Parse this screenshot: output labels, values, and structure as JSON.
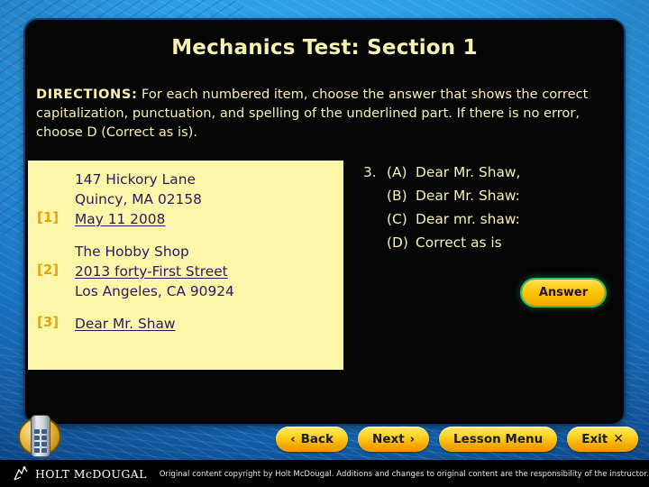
{
  "slide": {
    "title": "Mechanics Test: Section 1",
    "directions": {
      "lead": "DIRECTIONS:",
      "body": " For each numbered item, choose the answer that shows the correct capitalization, punctuation, and spelling of the underlined part. If there is no error, choose D (Correct as is)."
    }
  },
  "passage": {
    "rows": [
      {
        "num": "",
        "text": "147 Hickory Lane",
        "underline": false
      },
      {
        "num": "",
        "text": "Quincy, MA 02158",
        "underline": false
      },
      {
        "num": "[1]",
        "text": "May 11 2008",
        "underline": true
      },
      {
        "num": "",
        "text": "The Hobby Shop",
        "underline": false
      },
      {
        "num": "[2]",
        "text": "2013 forty-First Street",
        "underline": true
      },
      {
        "num": "",
        "text": "Los Angeles, CA 90924",
        "underline": false
      },
      {
        "num": "[3]",
        "text": "Dear Mr. Shaw",
        "underline": true
      }
    ]
  },
  "question": {
    "number": "3.",
    "choices": [
      {
        "label": "(A)",
        "text": "Dear Mr. Shaw,"
      },
      {
        "label": "(B)",
        "text": "Dear Mr. Shaw:"
      },
      {
        "label": "(C)",
        "text": "Dear mr. shaw:"
      },
      {
        "label": "(D)",
        "text": "Correct as is"
      }
    ]
  },
  "answer_button": {
    "label": "Answer"
  },
  "nav": {
    "back": {
      "label": "Back",
      "chevron": "‹"
    },
    "next": {
      "label": "Next",
      "chevron": "›"
    },
    "lesson_menu": {
      "label": "Lesson Menu"
    },
    "exit": {
      "label": "Exit",
      "mark": "✕"
    }
  },
  "footer": {
    "brand": "HOLT McDOUGAL",
    "copyright": "Original content copyright by Holt McDougal.  Additions and changes to original content are the responsibility of the instructor."
  },
  "colors": {
    "title_text": "#f7f2b0",
    "passage_bg": "#fbf6a8",
    "passage_text": "#2b1a63",
    "passage_num": "#e3a511",
    "button_gold": "#ffd21f",
    "answer_border_green": "#2bbf6a",
    "background_blue": "#2196e8"
  }
}
